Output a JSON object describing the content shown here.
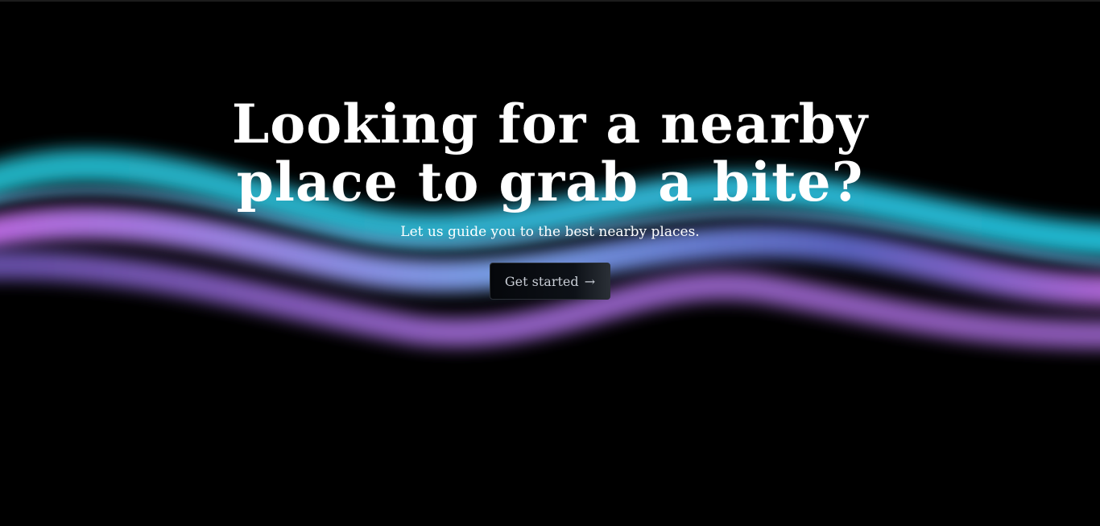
{
  "hero": {
    "headline_line1": "Looking for a nearby",
    "headline_line2": "place to grab a bite?",
    "subtitle": "Let us guide you to the best nearby places.",
    "cta_label": "Get started",
    "cta_arrow": "→"
  },
  "theme": {
    "background": "#000000",
    "wave_cyan": "#22c3e0",
    "wave_blue": "#6aa4f0",
    "wave_pink": "#c65fe6",
    "wave_purple": "#8a5ad0"
  }
}
